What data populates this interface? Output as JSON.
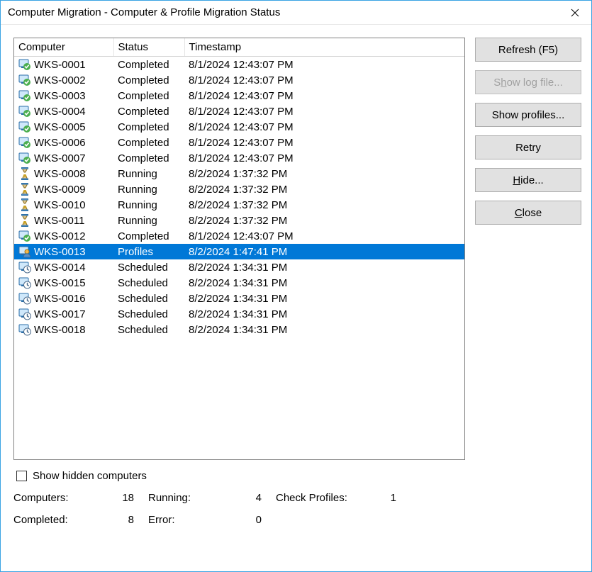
{
  "title": "Computer Migration - Computer & Profile Migration Status",
  "columns": {
    "computer": "Computer",
    "status": "Status",
    "timestamp": "Timestamp"
  },
  "rows": [
    {
      "computer": "WKS-0001",
      "status": "Completed",
      "timestamp": "8/1/2024 12:43:07 PM",
      "icon": "completed"
    },
    {
      "computer": "WKS-0002",
      "status": "Completed",
      "timestamp": "8/1/2024 12:43:07 PM",
      "icon": "completed"
    },
    {
      "computer": "WKS-0003",
      "status": "Completed",
      "timestamp": "8/1/2024 12:43:07 PM",
      "icon": "completed"
    },
    {
      "computer": "WKS-0004",
      "status": "Completed",
      "timestamp": "8/1/2024 12:43:07 PM",
      "icon": "completed"
    },
    {
      "computer": "WKS-0005",
      "status": "Completed",
      "timestamp": "8/1/2024 12:43:07 PM",
      "icon": "completed"
    },
    {
      "computer": "WKS-0006",
      "status": "Completed",
      "timestamp": "8/1/2024 12:43:07 PM",
      "icon": "completed"
    },
    {
      "computer": "WKS-0007",
      "status": "Completed",
      "timestamp": "8/1/2024 12:43:07 PM",
      "icon": "completed"
    },
    {
      "computer": "WKS-0008",
      "status": "Running",
      "timestamp": "8/2/2024 1:37:32 PM",
      "icon": "running"
    },
    {
      "computer": "WKS-0009",
      "status": "Running",
      "timestamp": "8/2/2024 1:37:32 PM",
      "icon": "running"
    },
    {
      "computer": "WKS-0010",
      "status": "Running",
      "timestamp": "8/2/2024 1:37:32 PM",
      "icon": "running"
    },
    {
      "computer": "WKS-0011",
      "status": "Running",
      "timestamp": "8/2/2024 1:37:32 PM",
      "icon": "running"
    },
    {
      "computer": "WKS-0012",
      "status": "Completed",
      "timestamp": "8/1/2024 12:43:07 PM",
      "icon": "completed"
    },
    {
      "computer": "WKS-0013",
      "status": "Profiles",
      "timestamp": "8/2/2024 1:47:41 PM",
      "icon": "profiles",
      "selected": true
    },
    {
      "computer": "WKS-0014",
      "status": "Scheduled",
      "timestamp": "8/2/2024 1:34:31 PM",
      "icon": "scheduled"
    },
    {
      "computer": "WKS-0015",
      "status": "Scheduled",
      "timestamp": "8/2/2024 1:34:31 PM",
      "icon": "scheduled"
    },
    {
      "computer": "WKS-0016",
      "status": "Scheduled",
      "timestamp": "8/2/2024 1:34:31 PM",
      "icon": "scheduled"
    },
    {
      "computer": "WKS-0017",
      "status": "Scheduled",
      "timestamp": "8/2/2024 1:34:31 PM",
      "icon": "scheduled"
    },
    {
      "computer": "WKS-0018",
      "status": "Scheduled",
      "timestamp": "8/2/2024 1:34:31 PM",
      "icon": "scheduled"
    }
  ],
  "buttons": {
    "refresh": "Refresh (F5)",
    "showLog_pre": "S",
    "showLog_ul": "h",
    "showLog_post": "ow log file...",
    "showProfiles": "Show profiles...",
    "retry": "Retry",
    "hide_pre": "",
    "hide_ul": "H",
    "hide_post": "ide...",
    "close_pre": "",
    "close_ul": "C",
    "close_post": "lose"
  },
  "checkbox": {
    "pre": "Show hidden ",
    "ul": "c",
    "post": "omputers",
    "checked": false
  },
  "stats": {
    "computers_label": "Computers:",
    "computers_value": "18",
    "running_label": "Running:",
    "running_value": "4",
    "checkprofiles_label": "Check Profiles:",
    "checkprofiles_value": "1",
    "completed_label": "Completed:",
    "completed_value": "8",
    "error_label": "Error:",
    "error_value": "0"
  }
}
